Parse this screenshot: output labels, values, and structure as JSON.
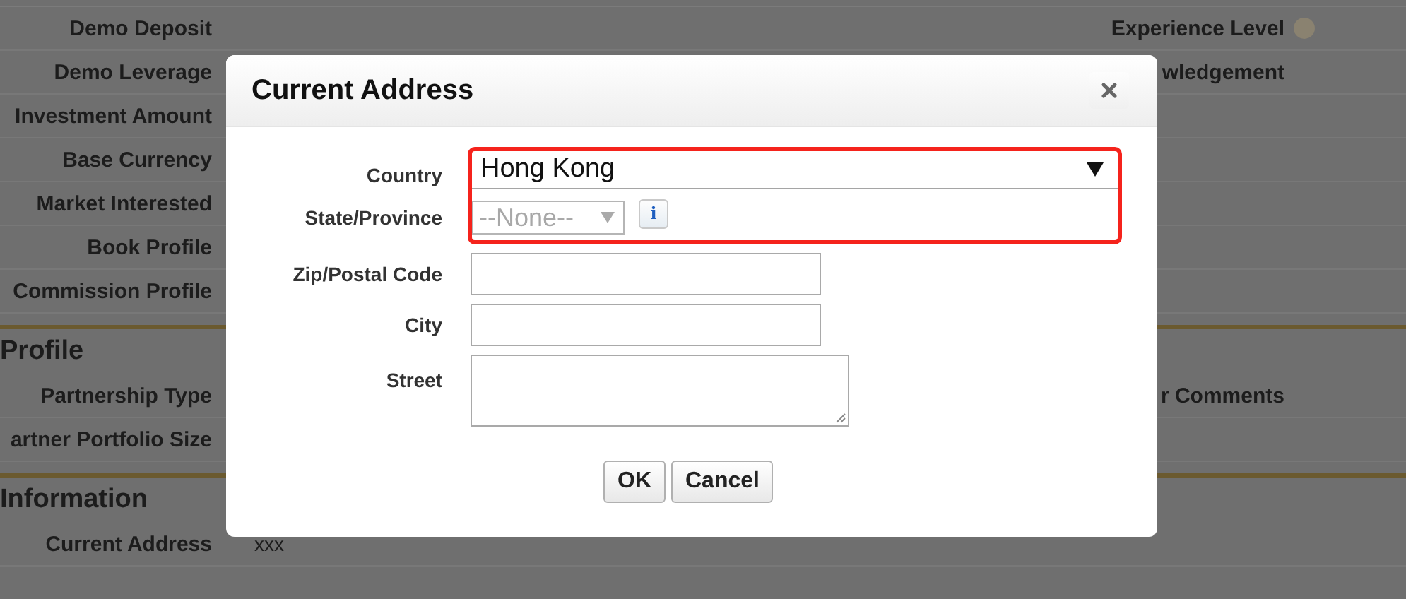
{
  "background": {
    "top_rows": [
      {
        "left": "Demo Deposit",
        "right": "Experience Level",
        "help": true
      },
      {
        "left": "Demo Leverage",
        "right": "wledgement",
        "help": false
      },
      {
        "left": "Investment Amount"
      },
      {
        "left": "Base Currency"
      },
      {
        "left": "Market Interested"
      },
      {
        "left": "Book Profile"
      },
      {
        "left": "Commission Profile"
      }
    ],
    "sections": [
      {
        "title": "Profile",
        "rows": [
          {
            "left": "Partnership Type",
            "right": "r Comments"
          },
          {
            "left": "artner Portfolio Size"
          }
        ]
      },
      {
        "title": "Information",
        "rows": [
          {
            "left": "Current Address",
            "value": "xxx"
          }
        ]
      }
    ]
  },
  "dialog": {
    "title": "Current Address",
    "fields": [
      {
        "label": "Country",
        "kind": "select",
        "value": "Hong Kong",
        "disabled": false,
        "highlighted": true
      },
      {
        "label": "State/Province",
        "kind": "select",
        "value": "--None--",
        "disabled": true,
        "highlighted": true,
        "info": "i"
      },
      {
        "label": "Zip/Postal Code",
        "kind": "text",
        "highlighted": false
      },
      {
        "label": "City",
        "kind": "text",
        "highlighted": false
      },
      {
        "label": "Street",
        "kind": "textarea",
        "highlighted": false
      }
    ],
    "buttons": [
      "OK",
      "Cancel"
    ]
  }
}
